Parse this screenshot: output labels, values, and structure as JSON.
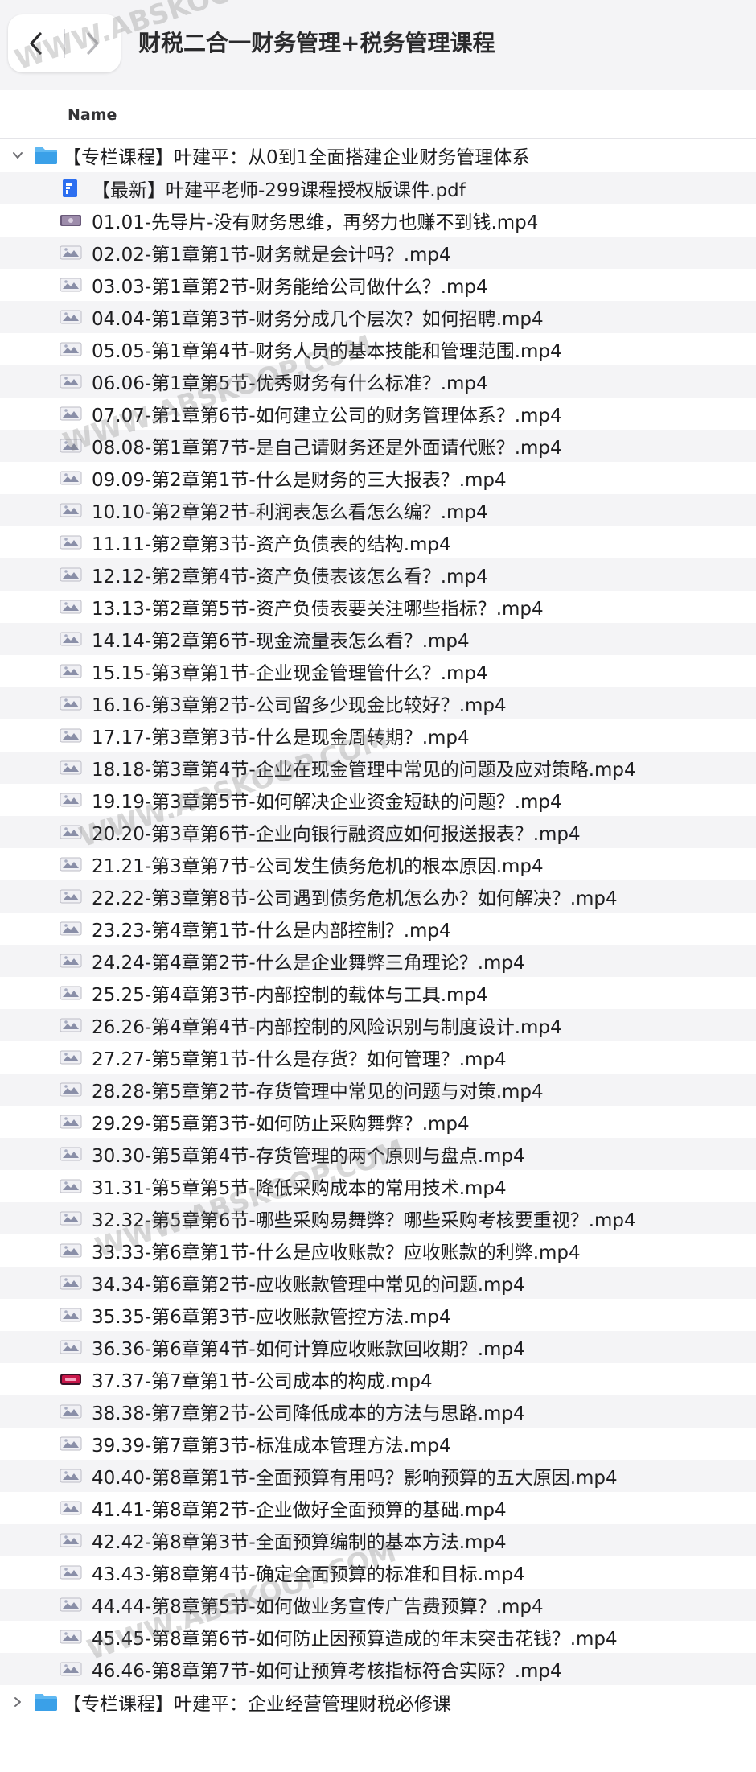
{
  "window": {
    "title": "财税二合一财务管理+税务管理课程"
  },
  "columns": {
    "name": "Name"
  },
  "tree": [
    {
      "label": "【专栏课程】叶建平：从0到1全面搭建企业财务管理体系",
      "expanded": true,
      "children": [
        {
          "label": "【最新】叶建平老师-299课程授权版课件.pdf",
          "kind": "pdf"
        },
        {
          "label": "01.01-先导片-没有财务思维，再努力也赚不到钱.mp4",
          "kind": "video-dark"
        },
        {
          "label": "02.02-第1章第1节-财务就是会计吗？.mp4",
          "kind": "video"
        },
        {
          "label": "03.03-第1章第2节-财务能给公司做什么？.mp4",
          "kind": "video"
        },
        {
          "label": "04.04-第1章第3节-财务分成几个层次？如何招聘.mp4",
          "kind": "video"
        },
        {
          "label": "05.05-第1章第4节-财务人员的基本技能和管理范围.mp4",
          "kind": "video"
        },
        {
          "label": "06.06-第1章第5节-优秀财务有什么标准？.mp4",
          "kind": "video"
        },
        {
          "label": "07.07-第1章第6节-如何建立公司的财务管理体系？.mp4",
          "kind": "video"
        },
        {
          "label": "08.08-第1章第7节-是自己请财务还是外面请代账？.mp4",
          "kind": "video"
        },
        {
          "label": "09.09-第2章第1节-什么是财务的三大报表？.mp4",
          "kind": "video"
        },
        {
          "label": "10.10-第2章第2节-利润表怎么看怎么编？.mp4",
          "kind": "video"
        },
        {
          "label": "11.11-第2章第3节-资产负债表的结构.mp4",
          "kind": "video"
        },
        {
          "label": "12.12-第2章第4节-资产负债表该怎么看？.mp4",
          "kind": "video"
        },
        {
          "label": "13.13-第2章第5节-资产负债表要关注哪些指标？.mp4",
          "kind": "video"
        },
        {
          "label": "14.14-第2章第6节-现金流量表怎么看？.mp4",
          "kind": "video"
        },
        {
          "label": "15.15-第3章第1节-企业现金管理管什么？.mp4",
          "kind": "video"
        },
        {
          "label": "16.16-第3章第2节-公司留多少现金比较好？.mp4",
          "kind": "video"
        },
        {
          "label": "17.17-第3章第3节-什么是现金周转期？.mp4",
          "kind": "video"
        },
        {
          "label": "18.18-第3章第4节-企业在现金管理中常见的问题及应对策略.mp4",
          "kind": "video"
        },
        {
          "label": "19.19-第3章第5节-如何解决企业资金短缺的问题？.mp4",
          "kind": "video"
        },
        {
          "label": "20.20-第3章第6节-企业向银行融资应如何报送报表？.mp4",
          "kind": "video"
        },
        {
          "label": "21.21-第3章第7节-公司发生债务危机的根本原因.mp4",
          "kind": "video"
        },
        {
          "label": "22.22-第3章第8节-公司遇到债务危机怎么办？如何解决？.mp4",
          "kind": "video"
        },
        {
          "label": "23.23-第4章第1节-什么是内部控制？.mp4",
          "kind": "video"
        },
        {
          "label": "24.24-第4章第2节-什么是企业舞弊三角理论？.mp4",
          "kind": "video"
        },
        {
          "label": "25.25-第4章第3节-内部控制的载体与工具.mp4",
          "kind": "video"
        },
        {
          "label": "26.26-第4章第4节-内部控制的风险识别与制度设计.mp4",
          "kind": "video"
        },
        {
          "label": "27.27-第5章第1节-什么是存货？如何管理？.mp4",
          "kind": "video"
        },
        {
          "label": "28.28-第5章第2节-存货管理中常见的问题与对策.mp4",
          "kind": "video"
        },
        {
          "label": "29.29-第5章第3节-如何防止采购舞弊？.mp4",
          "kind": "video"
        },
        {
          "label": "30.30-第5章第4节-存货管理的两个原则与盘点.mp4",
          "kind": "video"
        },
        {
          "label": "31.31-第5章第5节-降低采购成本的常用技术.mp4",
          "kind": "video"
        },
        {
          "label": "32.32-第5章第6节-哪些采购易舞弊？哪些采购考核要重视？.mp4",
          "kind": "video"
        },
        {
          "label": "33.33-第6章第1节-什么是应收账款？应收账款的利弊.mp4",
          "kind": "video"
        },
        {
          "label": "34.34-第6章第2节-应收账款管理中常见的问题.mp4",
          "kind": "video"
        },
        {
          "label": "35.35-第6章第3节-应收账款管控方法.mp4",
          "kind": "video"
        },
        {
          "label": "36.36-第6章第4节-如何计算应收账款回收期？.mp4",
          "kind": "video"
        },
        {
          "label": "37.37-第7章第1节-公司成本的构成.mp4",
          "kind": "video-red"
        },
        {
          "label": "38.38-第7章第2节-公司降低成本的方法与思路.mp4",
          "kind": "video"
        },
        {
          "label": "39.39-第7章第3节-标准成本管理方法.mp4",
          "kind": "video"
        },
        {
          "label": "40.40-第8章第1节-全面预算有用吗？影响预算的五大原因.mp4",
          "kind": "video"
        },
        {
          "label": "41.41-第8章第2节-企业做好全面预算的基础.mp4",
          "kind": "video"
        },
        {
          "label": "42.42-第8章第3节-全面预算编制的基本方法.mp4",
          "kind": "video"
        },
        {
          "label": "43.43-第8章第4节-确定全面预算的标准和目标.mp4",
          "kind": "video"
        },
        {
          "label": "44.44-第8章第5节-如何做业务宣传广告费预算？.mp4",
          "kind": "video"
        },
        {
          "label": "45.45-第8章第6节-如何防止因预算造成的年末突击花钱？.mp4",
          "kind": "video"
        },
        {
          "label": "46.46-第8章第7节-如何让预算考核指标符合实际？.mp4",
          "kind": "video"
        }
      ]
    },
    {
      "label": "【专栏课程】叶建平：企业经营管理财税必修课",
      "expanded": false,
      "children": []
    }
  ],
  "watermark": "WWW.ABSKOOP.COM",
  "colors": {
    "folder": "#3aa0e8",
    "pdf": "#2d6ff0",
    "video_red": "#c8174a"
  }
}
